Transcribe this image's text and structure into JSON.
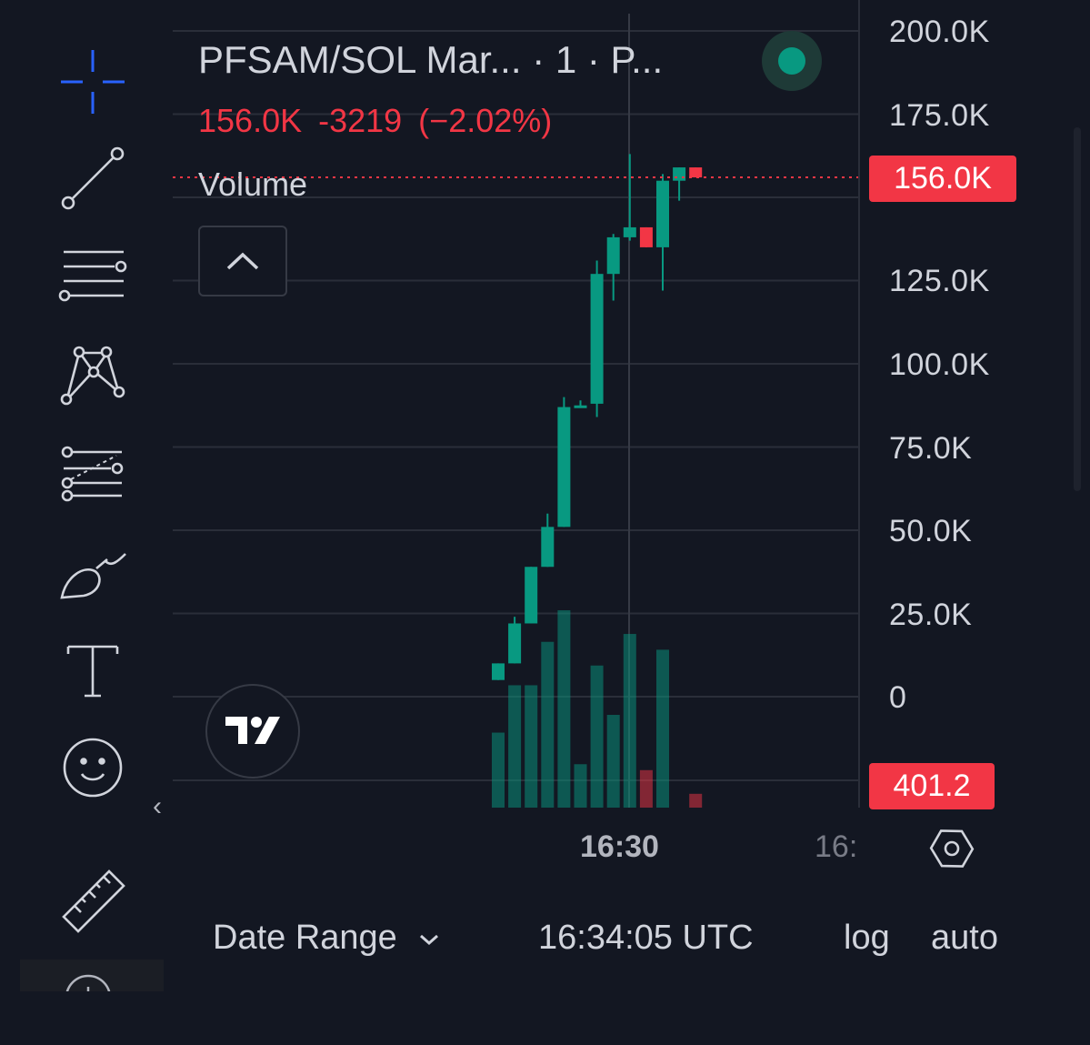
{
  "toolbar": {
    "tools": [
      {
        "name": "crosshair",
        "icon": "crosshair-icon"
      },
      {
        "name": "trend-line",
        "icon": "trend-line-icon"
      },
      {
        "name": "horizontal-lines",
        "icon": "horizontal-lines-icon"
      },
      {
        "name": "pattern",
        "icon": "pattern-icon"
      },
      {
        "name": "fib",
        "icon": "fib-retracement-icon"
      },
      {
        "name": "brush",
        "icon": "brush-icon"
      },
      {
        "name": "text",
        "icon": "text-icon"
      },
      {
        "name": "emoji",
        "icon": "smiley-icon"
      },
      {
        "name": "ruler",
        "icon": "ruler-icon"
      }
    ]
  },
  "legend": {
    "title": "PFSAM/SOL Mar...  · 1 · P...",
    "values": "156.0K  -3219 (−2.02%)",
    "volume_label": "Volume"
  },
  "price_axis": {
    "labels": [
      "200.0K",
      "175.0K",
      "125.0K",
      "100.0K",
      "75.0K",
      "50.0K",
      "25.0K",
      "0"
    ],
    "current_price_tag": "156.0K",
    "volume_tag": "401.2"
  },
  "time_axis": {
    "labels": [
      "16:30",
      "16:"
    ]
  },
  "bottom_bar": {
    "date_range": "Date Range",
    "clock": "16:34:05 UTC",
    "log": "log",
    "auto": "auto"
  },
  "colors": {
    "background": "#131722",
    "up": "#089981",
    "down": "#f23645",
    "grid": "#2a2e39",
    "text": "#d1d4dc"
  },
  "chart_data": {
    "type": "candlestick",
    "ylim": [
      0,
      200000
    ],
    "candles": [
      {
        "open": 5000,
        "close": 10000,
        "high": 10000,
        "low": 5000,
        "volume_level": 0.38
      },
      {
        "open": 10000,
        "close": 22000,
        "high": 24000,
        "low": 10000,
        "volume_level": 0.62
      },
      {
        "open": 22000,
        "close": 39000,
        "high": 39000,
        "low": 22000,
        "volume_level": 0.62
      },
      {
        "open": 39000,
        "close": 51000,
        "high": 55000,
        "low": 39000,
        "volume_level": 0.84
      },
      {
        "open": 51000,
        "close": 87000,
        "high": 90000,
        "low": 51000,
        "volume_level": 1.0
      },
      {
        "open": 87000,
        "close": 87500,
        "high": 89000,
        "low": 87000,
        "volume_level": 0.22
      },
      {
        "open": 88000,
        "close": 127000,
        "high": 131000,
        "low": 84000,
        "volume_level": 0.72
      },
      {
        "open": 127000,
        "close": 138000,
        "high": 139000,
        "low": 119000,
        "volume_level": 0.47
      },
      {
        "open": 138000,
        "close": 141000,
        "high": 163000,
        "low": 137000,
        "volume_level": 0.88
      },
      {
        "open": 141000,
        "close": 135000,
        "high": 141000,
        "low": 135000,
        "volume_level": 0.19
      },
      {
        "open": 135000,
        "close": 155000,
        "high": 157000,
        "low": 122000,
        "volume_level": 0.8
      },
      {
        "open": 155000,
        "close": 159000,
        "high": 159000,
        "low": 149000,
        "volume_level": 0.0
      },
      {
        "open": 159000,
        "close": 156000,
        "high": 159000,
        "low": 156000,
        "volume_level": 0.07
      }
    ],
    "last_price": 156000
  }
}
